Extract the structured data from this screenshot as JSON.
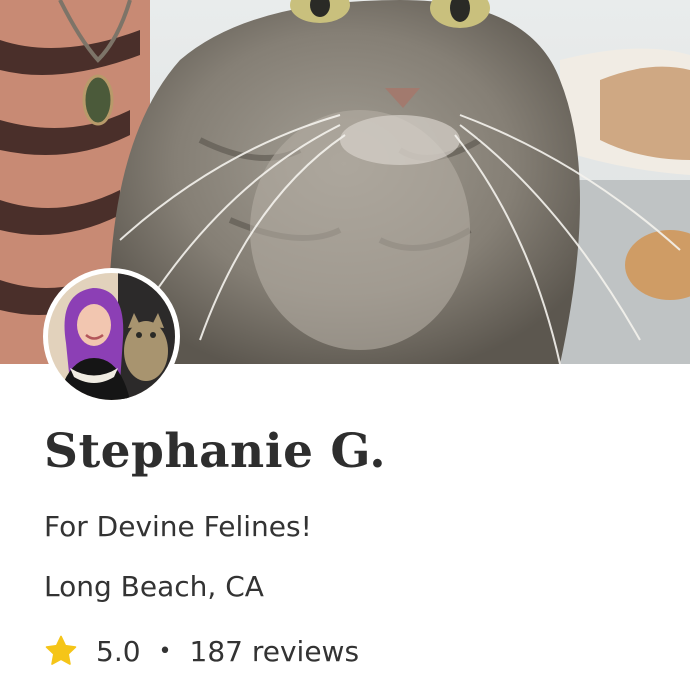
{
  "profile": {
    "name": "Stephanie G.",
    "tagline": "For Devine Felines!",
    "location": "Long Beach, CA",
    "rating": "5.0",
    "separator": "•",
    "reviews": "187 reviews"
  },
  "colors": {
    "star": "#f5c518",
    "text": "#2e2e2e",
    "background": "#ffffff"
  },
  "icons": {
    "rating": "star-icon"
  }
}
